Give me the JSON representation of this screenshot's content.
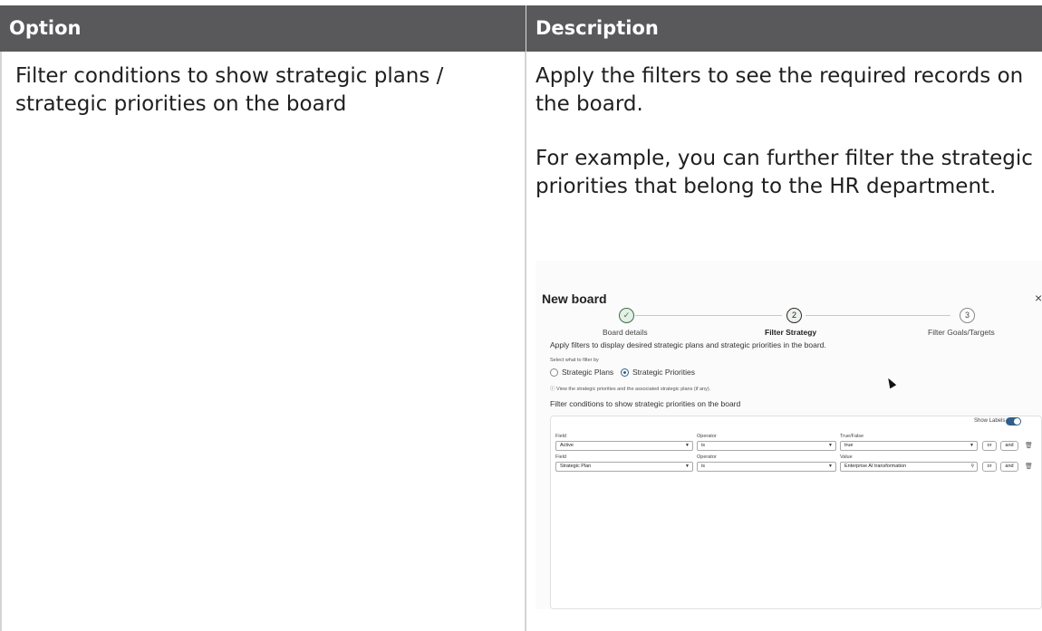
{
  "table": {
    "headers": {
      "option": "Option",
      "description": "Description"
    },
    "row": {
      "option": "Filter conditions to show strategic plans / strategic priorities on the board",
      "description_p1": "Apply the filters to see the required records on the board.",
      "description_p2": "For example, you can further filter the strategic priorities that belong to the HR department."
    }
  },
  "screenshot": {
    "title": "New board",
    "close_glyph": "×",
    "steps": [
      {
        "number": "✓",
        "label": "Board details"
      },
      {
        "number": "2",
        "label": "Filter Strategy"
      },
      {
        "number": "3",
        "label": "Filter Goals/Targets"
      }
    ],
    "instruction": "Apply filters to display desired strategic plans and strategic priorities in the board.",
    "select_label": "Select what to filter by",
    "radio_options": [
      "Strategic Plans",
      "Strategic Priorities"
    ],
    "selected_option": "Strategic Priorities",
    "info_text": "View the strategic priorities and the associated strategic plans (if any).",
    "filter_title": "Filter conditions to show strategic priorities on the board",
    "show_labels": "Show Labels",
    "show_labels_on": true,
    "conditions": [
      {
        "field_label": "Field",
        "field": "Active",
        "operator_label": "Operator",
        "operator": "is",
        "value_label": "True/False",
        "value": "true"
      },
      {
        "field_label": "Field",
        "field": "Strategic Plan",
        "operator_label": "Operator",
        "operator": "is",
        "value_label": "Value",
        "value": "Enterprise AI transformation"
      }
    ],
    "or_label": "or",
    "and_label": "and",
    "icons": {
      "caret": "caret-down-icon",
      "search": "search-icon",
      "delete": "trash-icon",
      "step_done": "check-icon"
    },
    "colors": {
      "header_bg": "#59595b",
      "accent": "#2f5f8a",
      "step_done": "#3c6e48"
    }
  }
}
